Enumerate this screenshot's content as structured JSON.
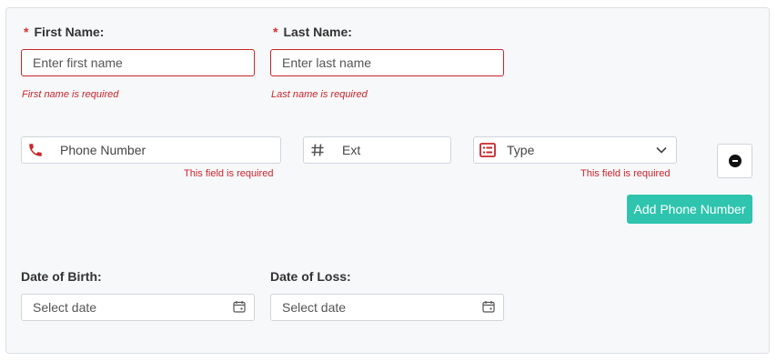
{
  "name": {
    "first_label": "First Name:",
    "first_placeholder": "Enter first name",
    "first_error": "First name is required",
    "last_label": "Last Name:",
    "last_placeholder": "Enter last name",
    "last_error": "Last name is required",
    "required_mark": "*"
  },
  "phone": {
    "number_placeholder": "Phone Number",
    "number_error": "This field is required",
    "ext_placeholder": "Ext",
    "type_placeholder": "Type",
    "type_error": "This field is required",
    "add_button": "Add Phone Number",
    "icon_names": [
      "phone-icon",
      "hash-icon",
      "list-icon",
      "chevron-down-icon",
      "minus-circle-icon"
    ]
  },
  "dates": {
    "birth_label": "Date of Birth:",
    "birth_placeholder": "Select date",
    "loss_label": "Date of Loss:",
    "loss_placeholder": "Select date"
  },
  "colors": {
    "error": "#c9252b",
    "accent_button": "#2ec4ae",
    "panel_bg": "#f7f8fa"
  }
}
